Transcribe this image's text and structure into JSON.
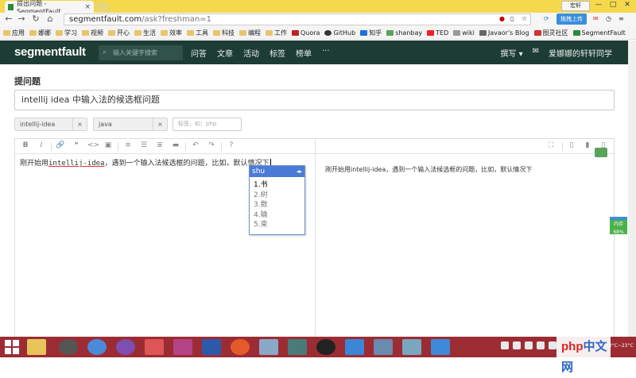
{
  "browser": {
    "tab_title": "提出问题 - SegmentFault",
    "tab_close": "×",
    "user_badge": "宏轩",
    "win_min": "—",
    "win_max": "□",
    "win_close": "✕",
    "url_host": "segmentfault.com",
    "url_path": "/ask?freshman=1",
    "upload_label": "拖拽上传",
    "bookmarks": [
      "应用",
      "娜娜",
      "学习",
      "视频",
      "开心",
      "生活",
      "效率",
      "工具",
      "科技",
      "编程",
      "工作",
      "Quora",
      "GitHub",
      "知乎",
      "shanbay",
      "TED",
      "wiki",
      "Javaor's Blog",
      "图灵社区",
      "SegmentFault"
    ]
  },
  "site": {
    "logo": "segmentfault",
    "search_placeholder": "输入关键字搜索",
    "nav": [
      "问答",
      "文章",
      "活动",
      "标签",
      "榜单",
      "···"
    ],
    "write_label": "撰写 ▾",
    "mail_icon_label": "✉",
    "username": "爱娜娜的轩轩同学"
  },
  "form": {
    "page_title": "提问题",
    "question_title": "intellij idea 中输入法的候选框问题",
    "tags": [
      "intellij-idea",
      "java"
    ],
    "tag_remove": "×",
    "tag_placeholder": "标签，如：php"
  },
  "editor": {
    "toolbar": [
      "B",
      "I",
      "🔗",
      "❝",
      "<>",
      "▣",
      "≡",
      "☰",
      "≣",
      "▬",
      "↶",
      "↷",
      "?"
    ],
    "toolbar_right": [
      "⛶",
      "▯",
      "▮",
      "▯"
    ],
    "text_before": "刚开始用",
    "text_code": "intellij-idea",
    "text_after": "，遇到一个输入法候选框的问题，比如，默认情况下",
    "preview": "刚开始用intellij-idea，遇到一个输入法候选框的问题，比如，默认情况下"
  },
  "ime": {
    "composition": "shu",
    "arrows": "◂▸",
    "candidates": [
      "1.书",
      "2.树",
      "3.数",
      "4.输",
      "5.束"
    ]
  },
  "widgets": {
    "mem_label": "内存",
    "mem_value": "68%"
  },
  "taskbar": {
    "php_text_a": "php",
    "php_text_b": "中文网",
    "clock": "12°C~23°C"
  }
}
